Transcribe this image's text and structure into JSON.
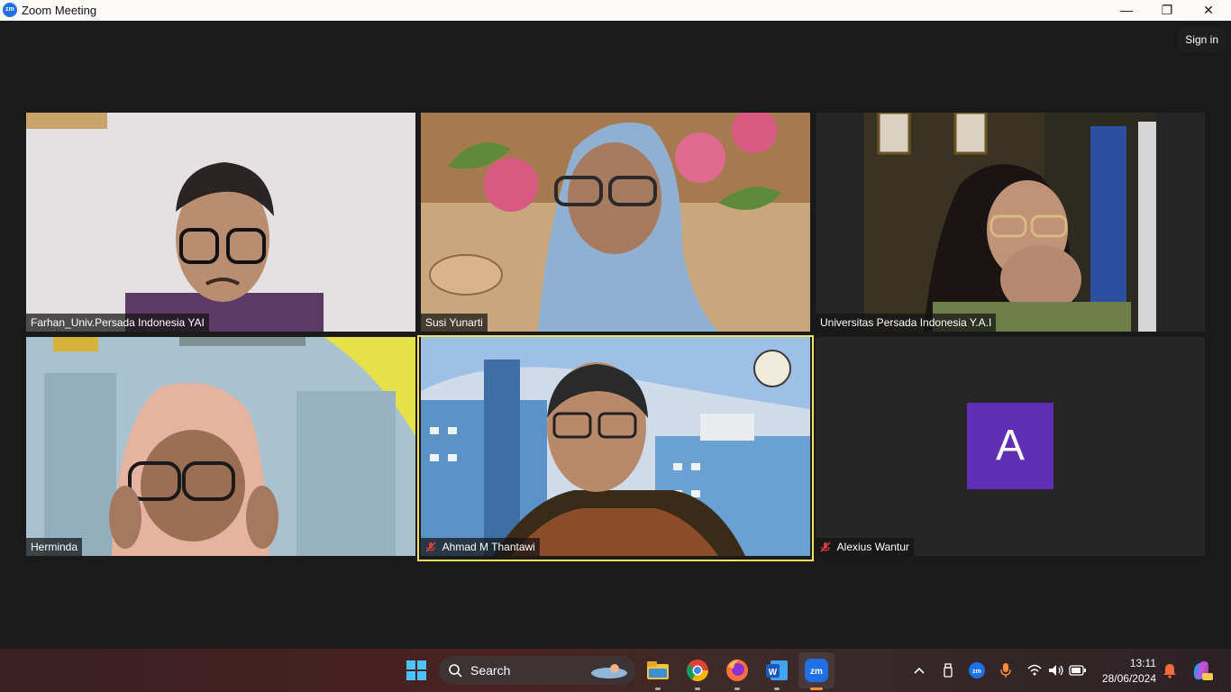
{
  "window": {
    "title": "Zoom Meeting",
    "app_icon_text": "zm",
    "minimize_glyph": "—",
    "maximize_glyph": "❐",
    "close_glyph": "✕"
  },
  "meeting": {
    "signin_label": "Sign in",
    "participants": [
      {
        "name": "Farhan_Univ.Persada Indonesia YAI",
        "muted": false
      },
      {
        "name": "Susi Yunarti",
        "muted": false
      },
      {
        "name": "Universitas Persada Indonesia Y.A.I",
        "muted": false
      },
      {
        "name": "Herminda",
        "muted": false
      },
      {
        "name": "Ahmad M Thantawi",
        "muted": true,
        "active_speaker": true
      },
      {
        "name": "Alexius Wantur",
        "muted": true,
        "avatar_letter": "A",
        "avatar_color": "#5f2eb5"
      }
    ]
  },
  "taskbar": {
    "search_label": "Search",
    "apps": [
      "windows-start",
      "search",
      "file-explorer",
      "chrome",
      "firefox",
      "word",
      "zoom"
    ],
    "clock_time": "13:11",
    "clock_date": "28/06/2024"
  },
  "colors": {
    "active_speaker_border": "#f7e05c",
    "meeting_background": "#1a1a1a"
  }
}
